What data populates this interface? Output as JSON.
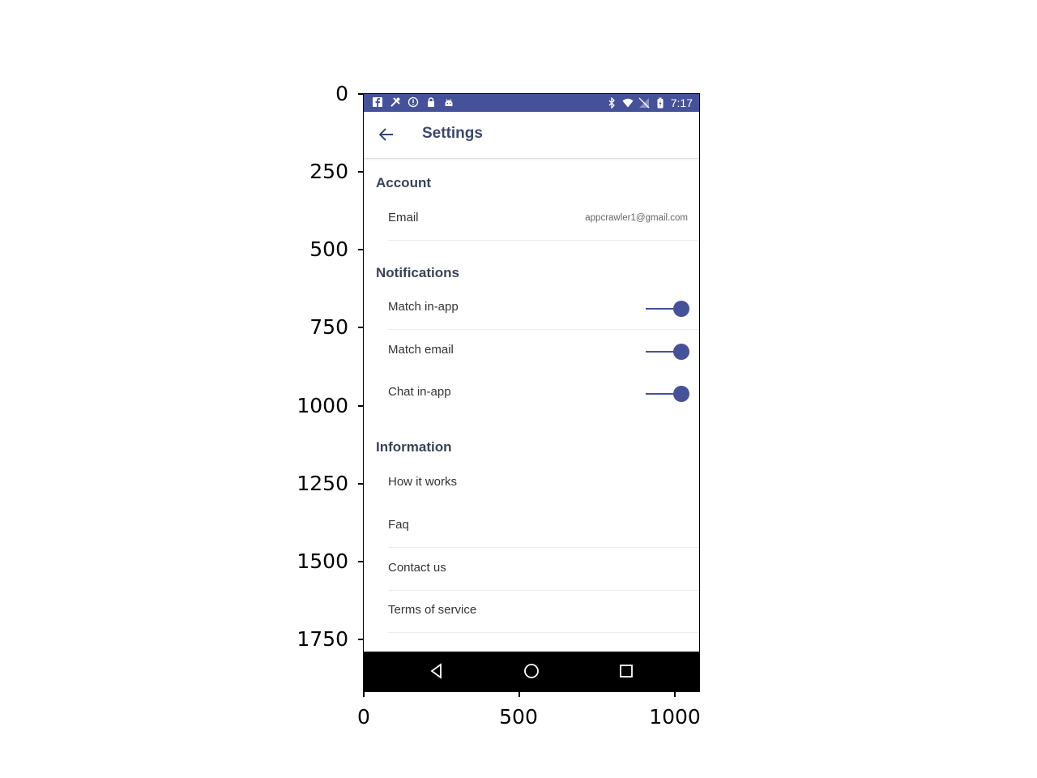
{
  "axes": {
    "y_ticks": [
      "0",
      "250",
      "500",
      "750",
      "1000",
      "1250",
      "1500",
      "1750"
    ],
    "x_ticks": [
      "0",
      "500",
      "1000"
    ]
  },
  "status_bar": {
    "time": "7:17",
    "left_icons": [
      "facebook-icon",
      "tools-icon",
      "info-circle-icon",
      "lock-icon",
      "android-icon"
    ],
    "right_icons": [
      "bluetooth-icon",
      "wifi-icon",
      "no-signal-icon",
      "battery-charging-icon"
    ],
    "color": "#45529a"
  },
  "toolbar": {
    "title": "Settings",
    "back_icon": "arrow-left-icon"
  },
  "sections": {
    "account": {
      "header": "Account",
      "email_label": "Email",
      "email_value": "appcrawler1@gmail.com"
    },
    "notifications": {
      "header": "Notifications",
      "items": [
        {
          "label": "Match in-app",
          "enabled": true
        },
        {
          "label": "Match email",
          "enabled": true
        },
        {
          "label": "Chat in-app",
          "enabled": true
        }
      ]
    },
    "information": {
      "header": "Information",
      "items": [
        "How it works",
        "Faq",
        "Contact us",
        "Terms of service"
      ]
    }
  },
  "nav_bar": {
    "icons": [
      "back-triangle-icon",
      "home-circle-icon",
      "recents-square-icon"
    ]
  },
  "colors": {
    "accent": "#45529a",
    "header_text": "#394357"
  }
}
